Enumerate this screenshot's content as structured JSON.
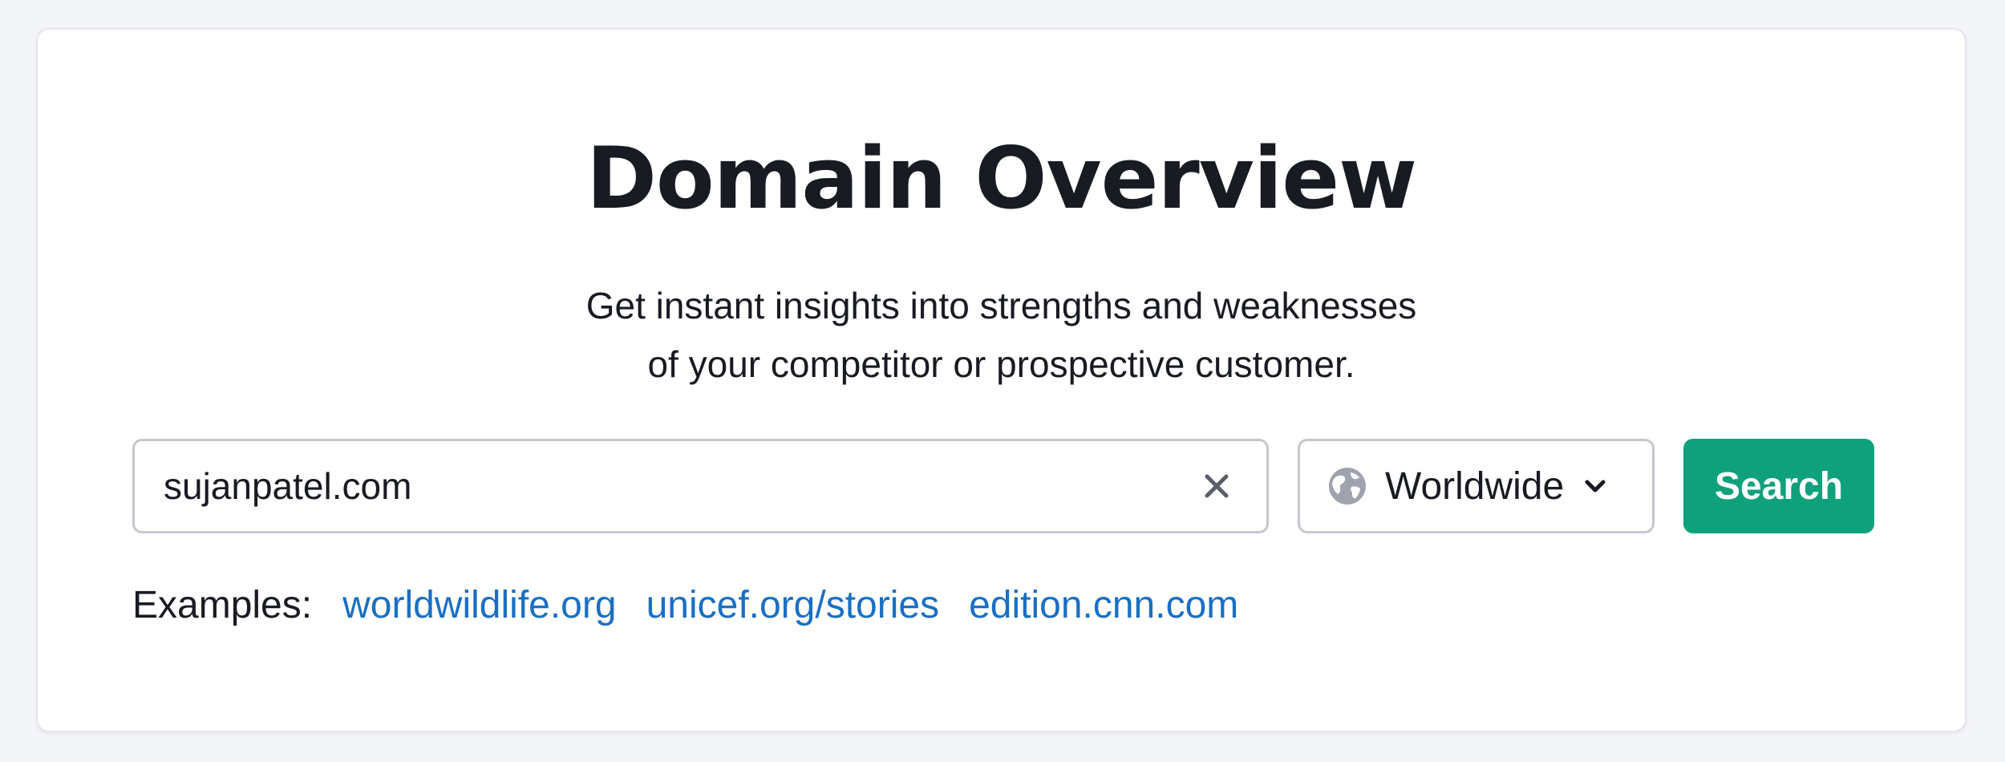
{
  "header": {
    "title": "Domain Overview",
    "subtitle_line1": "Get instant insights into strengths and weaknesses",
    "subtitle_line2": "of your competitor or prospective customer."
  },
  "search": {
    "value": "sujanpatel.com",
    "clear_icon": "close-icon",
    "region": {
      "selected": "Worldwide",
      "icon": "globe-icon",
      "dropdown_icon": "chevron-down-icon"
    },
    "button_label": "Search"
  },
  "examples": {
    "label": "Examples:",
    "links": [
      "worldwildlife.org",
      "unicef.org/stories",
      "edition.cnn.com"
    ]
  },
  "colors": {
    "accent": "#0ea17c",
    "link": "#1a6fc4",
    "text": "#191b23",
    "border": "#c5c7cf"
  }
}
